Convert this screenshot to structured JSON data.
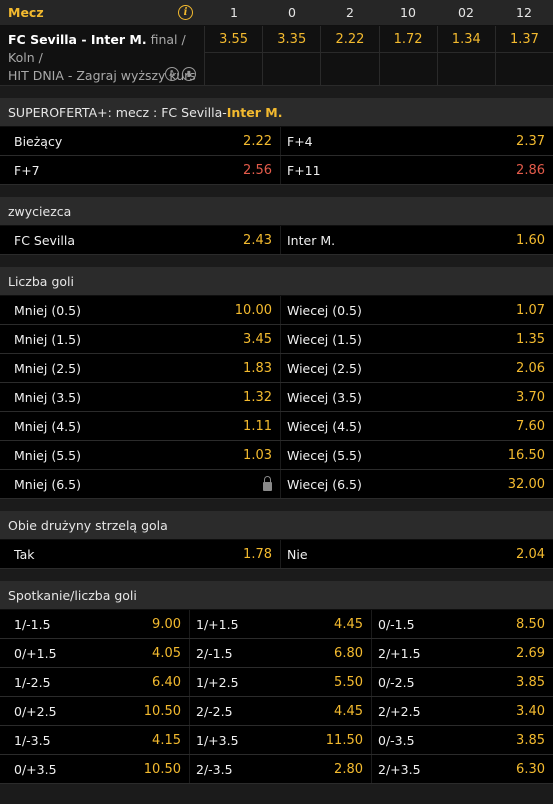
{
  "header": {
    "mecz": "Mecz",
    "info_icon": "info-icon",
    "cols": [
      "1",
      "0",
      "2",
      "10",
      "02",
      "12"
    ]
  },
  "match": {
    "teams": "FC Sevilla - Inter M.",
    "status": " final / Koln /",
    "promo": "HIT DNIA - Zagraj wyższy kurs",
    "odds": [
      "3.55",
      "3.35",
      "2.22",
      "1.72",
      "1.34",
      "1.37"
    ]
  },
  "superoferta": {
    "title_prefix": "SUPEROFERTA+: mecz : FC Sevilla-",
    "title_hl": "Inter M.",
    "rows": [
      [
        {
          "label": "Bieżący",
          "value": "2.22",
          "red": false
        },
        {
          "label": "F+4",
          "value": "2.37",
          "red": false
        }
      ],
      [
        {
          "label": "F+7",
          "value": "2.56",
          "red": true
        },
        {
          "label": "F+11",
          "value": "2.86",
          "red": true
        }
      ]
    ]
  },
  "zwyciezca": {
    "title": "zwyciezca",
    "rows": [
      [
        {
          "label": "FC Sevilla",
          "value": "2.43"
        },
        {
          "label": "Inter M.",
          "value": "1.60"
        }
      ]
    ]
  },
  "gole": {
    "title": "Liczba goli",
    "rows": [
      [
        {
          "label": "Mniej (0.5)",
          "value": "10.00"
        },
        {
          "label": "Wiecej (0.5)",
          "value": "1.07"
        }
      ],
      [
        {
          "label": "Mniej (1.5)",
          "value": "3.45"
        },
        {
          "label": "Wiecej (1.5)",
          "value": "1.35"
        }
      ],
      [
        {
          "label": "Mniej (2.5)",
          "value": "1.83"
        },
        {
          "label": "Wiecej (2.5)",
          "value": "2.06"
        }
      ],
      [
        {
          "label": "Mniej (3.5)",
          "value": "1.32"
        },
        {
          "label": "Wiecej (3.5)",
          "value": "3.70"
        }
      ],
      [
        {
          "label": "Mniej (4.5)",
          "value": "1.11"
        },
        {
          "label": "Wiecej (4.5)",
          "value": "7.60"
        }
      ],
      [
        {
          "label": "Mniej (5.5)",
          "value": "1.03"
        },
        {
          "label": "Wiecej (5.5)",
          "value": "16.50"
        }
      ],
      [
        {
          "label": "Mniej (6.5)",
          "value": "",
          "locked": true
        },
        {
          "label": "Wiecej (6.5)",
          "value": "32.00"
        }
      ]
    ]
  },
  "obie": {
    "title": "Obie drużyny strzelą gola",
    "rows": [
      [
        {
          "label": "Tak",
          "value": "1.78"
        },
        {
          "label": "Nie",
          "value": "2.04"
        }
      ]
    ]
  },
  "spotkanie": {
    "title": "Spotkanie/liczba goli",
    "rows": [
      [
        {
          "label": "1/-1.5",
          "value": "9.00"
        },
        {
          "label": "1/+1.5",
          "value": "4.45"
        },
        {
          "label": "0/-1.5",
          "value": "8.50"
        }
      ],
      [
        {
          "label": "0/+1.5",
          "value": "4.05"
        },
        {
          "label": "2/-1.5",
          "value": "6.80"
        },
        {
          "label": "2/+1.5",
          "value": "2.69"
        }
      ],
      [
        {
          "label": "1/-2.5",
          "value": "6.40"
        },
        {
          "label": "1/+2.5",
          "value": "5.50"
        },
        {
          "label": "0/-2.5",
          "value": "3.85"
        }
      ],
      [
        {
          "label": "0/+2.5",
          "value": "10.50"
        },
        {
          "label": "2/-2.5",
          "value": "4.45"
        },
        {
          "label": "2/+2.5",
          "value": "3.40"
        }
      ],
      [
        {
          "label": "1/-3.5",
          "value": "4.15"
        },
        {
          "label": "1/+3.5",
          "value": "11.50"
        },
        {
          "label": "0/-3.5",
          "value": "3.85"
        }
      ],
      [
        {
          "label": "0/+3.5",
          "value": "10.50"
        },
        {
          "label": "2/-3.5",
          "value": "2.80"
        },
        {
          "label": "2/+3.5",
          "value": "6.30"
        }
      ]
    ]
  },
  "colors": {
    "accent": "#f3ba2f",
    "drop": "#e35b4a",
    "row_bg": "#000000",
    "section_bg": "#2b2b2b"
  }
}
